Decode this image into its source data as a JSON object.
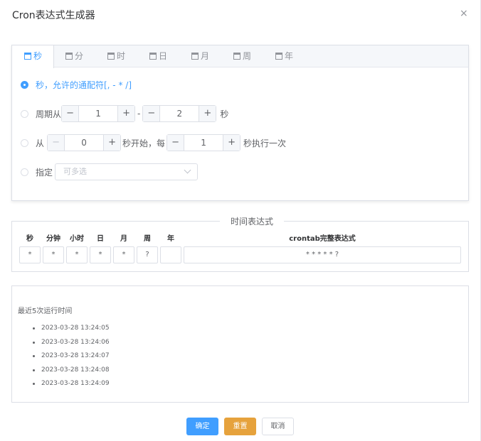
{
  "dialog": {
    "title": "Cron表达式生成器",
    "close_icon": "×"
  },
  "tabs": [
    {
      "label": "秒"
    },
    {
      "label": "分"
    },
    {
      "label": "时"
    },
    {
      "label": "日"
    },
    {
      "label": "月"
    },
    {
      "label": "周"
    },
    {
      "label": "年"
    }
  ],
  "second_tab": {
    "opt_any": "秒，允许的通配符[, - * /]",
    "opt_cycle_prefix": "周期从",
    "cycle_from": "1",
    "cycle_dash": "-",
    "cycle_to": "2",
    "cycle_suffix": "秒",
    "opt_from_prefix": "从",
    "from_start": "0",
    "from_mid": "秒开始，每",
    "from_every": "1",
    "from_suffix": "秒执行一次",
    "opt_specify": "指定",
    "specify_placeholder": "可多选",
    "stepper_minus": "−",
    "stepper_plus": "+"
  },
  "expression": {
    "legend": "时间表达式",
    "headers": [
      "秒",
      "分钟",
      "小时",
      "日",
      "月",
      "周",
      "年"
    ],
    "values": [
      "*",
      "*",
      "*",
      "*",
      "*",
      "?",
      ""
    ],
    "full_header": "crontab完整表达式",
    "full_value": "* * * * * ?"
  },
  "run_times": {
    "label": "最近5次运行时间",
    "items": [
      "2023-03-28 13:24:05",
      "2023-03-28 13:24:06",
      "2023-03-28 13:24:07",
      "2023-03-28 13:24:08",
      "2023-03-28 13:24:09"
    ]
  },
  "footer": {
    "ok": "确定",
    "reset": "重置",
    "cancel": "取消"
  },
  "colors": {
    "primary": "#409eff",
    "warning": "#e6a23c",
    "border": "#dcdfe6"
  }
}
